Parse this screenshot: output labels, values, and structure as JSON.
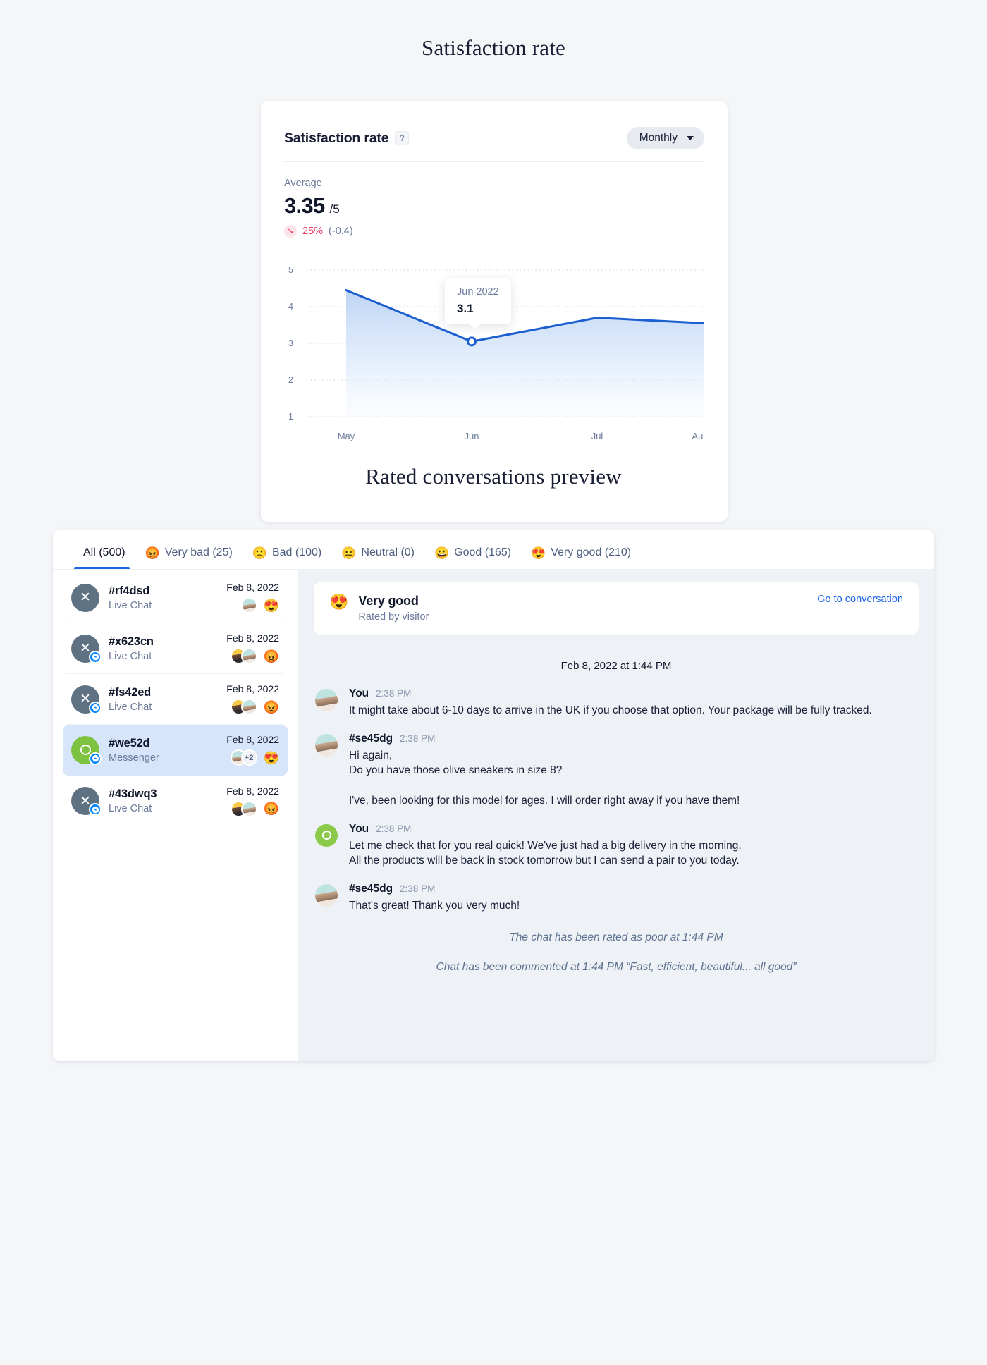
{
  "headings": {
    "satisfaction": "Satisfaction rate",
    "rated": "Rated conversations preview"
  },
  "satisfaction_card": {
    "title": "Satisfaction rate",
    "help_icon_label": "?",
    "period_selector": {
      "value": "Monthly"
    },
    "average_label": "Average",
    "average_value": "3.35",
    "average_out_of": "/5",
    "delta_icon": "↘",
    "delta_percent": "25%",
    "delta_absolute": "(-0.4)",
    "tooltip": {
      "label": "Jun 2022",
      "value": "3.1"
    },
    "colors": {
      "line": "#1b5fd0",
      "area_top": "#bcd4f5",
      "negative": "#e8365d",
      "accent": "#1b66e3"
    }
  },
  "chart_data": {
    "type": "line",
    "title": "Satisfaction rate",
    "xlabel": "",
    "ylabel": "",
    "categories": [
      "May",
      "Jun",
      "Jul",
      "Aug"
    ],
    "x_tick_labels": [
      "May",
      "Jun",
      "Jul",
      "Aug"
    ],
    "y_tick_labels": [
      "5",
      "4",
      "3",
      "2",
      "1"
    ],
    "ylim": [
      1,
      5
    ],
    "yticks": [
      1,
      2,
      3,
      4,
      5
    ],
    "grid": true,
    "legend": "none",
    "series": [
      {
        "name": "Satisfaction rate",
        "values": [
          4.45,
          3.05,
          3.7,
          3.55
        ]
      }
    ],
    "annotations": [
      {
        "x": "Jun",
        "label": "Jun 2022",
        "value": "3.1",
        "type": "tooltip"
      }
    ],
    "area_fill": true
  },
  "rated_card": {
    "tabs": [
      {
        "label": "All (500)",
        "emoji": "",
        "active": true
      },
      {
        "label": "Very bad (25)",
        "emoji": "😡",
        "active": false
      },
      {
        "label": "Bad (100)",
        "emoji": "🙁",
        "active": false
      },
      {
        "label": "Neutral (0)",
        "emoji": "😐",
        "active": false
      },
      {
        "label": "Good (165)",
        "emoji": "😀",
        "active": false
      },
      {
        "label": "Very good (210)",
        "emoji": "😍",
        "active": false
      }
    ],
    "conversations": [
      {
        "id": "#rf4dsd",
        "source": "Live Chat",
        "date": "Feb 8, 2022",
        "avatar_kind": "gray-x",
        "messenger_badge": false,
        "participants": [
          "teal"
        ],
        "extra": "",
        "rating_emoji": "😍",
        "selected": false
      },
      {
        "id": "#x623cn",
        "source": "Live Chat",
        "date": "Feb 8, 2022",
        "avatar_kind": "gray-x",
        "messenger_badge": true,
        "participants": [
          "gold",
          "teal"
        ],
        "extra": "",
        "rating_emoji": "😡",
        "selected": false
      },
      {
        "id": "#fs42ed",
        "source": "Live Chat",
        "date": "Feb 8, 2022",
        "avatar_kind": "gray-x",
        "messenger_badge": true,
        "participants": [
          "gold",
          "teal"
        ],
        "extra": "",
        "rating_emoji": "😡",
        "selected": false
      },
      {
        "id": "#we52d",
        "source": "Messenger",
        "date": "Feb 8, 2022",
        "avatar_kind": "green-ring",
        "messenger_badge": true,
        "participants": [
          "teal"
        ],
        "extra": "+2",
        "rating_emoji": "😍",
        "selected": true
      },
      {
        "id": "#43dwq3",
        "source": "Live Chat",
        "date": "Feb 8, 2022",
        "avatar_kind": "gray-x",
        "messenger_badge": true,
        "participants": [
          "gold",
          "teal"
        ],
        "extra": "",
        "rating_emoji": "😡",
        "selected": false
      }
    ],
    "preview": {
      "rating_emoji": "😍",
      "rating_title": "Very good",
      "rating_subtitle": "Rated by visitor",
      "goto_link": "Go to conversation",
      "date_separator": "Feb 8, 2022 at 1:44 PM",
      "messages": [
        {
          "author": "You",
          "time": "2:38 PM",
          "avatar": "teal",
          "text": "It might take about 6-10 days to arrive in the UK if you choose that option. Your package will be fully tracked.",
          "spacer_before_second": false,
          "text2": ""
        },
        {
          "author": "#se45dg",
          "time": "2:38 PM",
          "avatar": "teal",
          "text": "Hi again,\nDo you have those olive sneakers in size 8?",
          "spacer_before_second": true,
          "text2": "I've, been looking for this model for ages. I will order right away if you have them!"
        },
        {
          "author": "You",
          "time": "2:38 PM",
          "avatar": "green",
          "text": "Let me check that for you real quick! We've just had a big delivery in the morning.\nAll the products will be back in stock tomorrow but I can send a pair to you today.",
          "spacer_before_second": false,
          "text2": ""
        },
        {
          "author": "#se45dg",
          "time": "2:38 PM",
          "avatar": "teal",
          "text": "That's great! Thank you very much!",
          "spacer_before_second": false,
          "text2": ""
        }
      ],
      "system_notes": [
        "The chat has been rated as poor at 1:44 PM",
        "Chat has been commented at 1:44 PM “Fast, efficient, beautiful... all good”"
      ]
    }
  }
}
